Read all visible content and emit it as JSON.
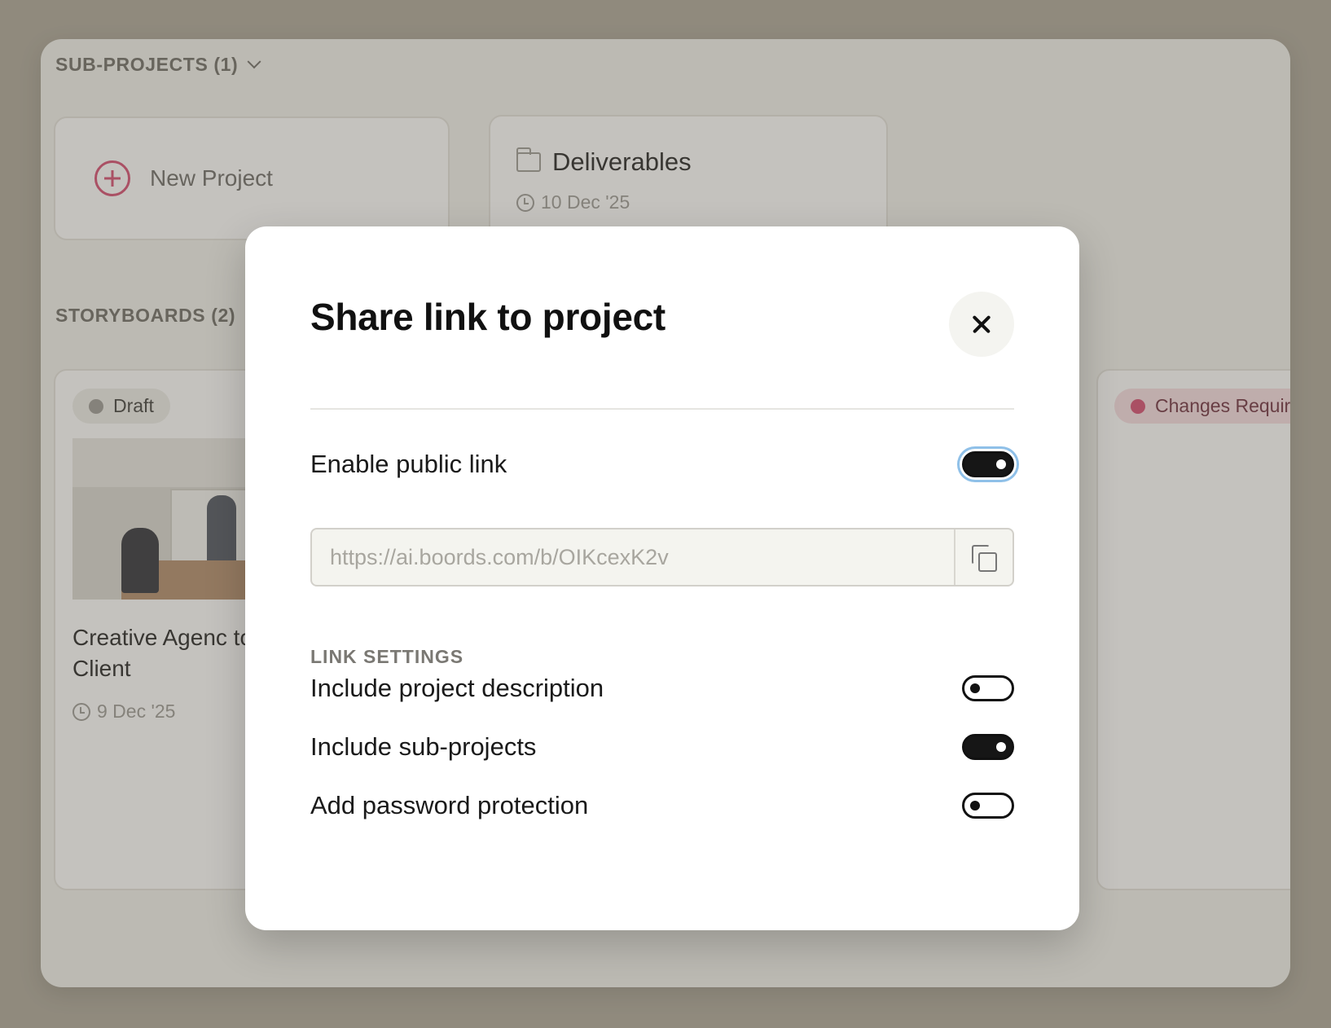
{
  "background": {
    "subprojects": {
      "heading": "SUB-PROJECTS (1)",
      "new_project_label": "New Project",
      "deliverables": {
        "title": "Deliverables",
        "date": "10 Dec '25"
      }
    },
    "storyboards": {
      "heading": "STORYBOARDS (2)",
      "cards": [
        {
          "status": "Draft",
          "status_color": "#9a9893",
          "title": "Creative Agenc to Client",
          "date": "9 Dec '25"
        },
        {
          "status": "Changes Requir",
          "status_color": "#d5486f"
        }
      ]
    }
  },
  "modal": {
    "title": "Share link to project",
    "enable_public_link": {
      "label": "Enable public link",
      "enabled": true
    },
    "url": "https://ai.boords.com/b/OIKcexK2v",
    "link_settings_heading": "LINK SETTINGS",
    "settings": [
      {
        "label": "Include project description",
        "enabled": false
      },
      {
        "label": "Include sub-projects",
        "enabled": true
      },
      {
        "label": "Add password protection",
        "enabled": false
      }
    ]
  },
  "colors": {
    "accent": "#d5486f",
    "focus_ring": "#8fc0e8"
  }
}
